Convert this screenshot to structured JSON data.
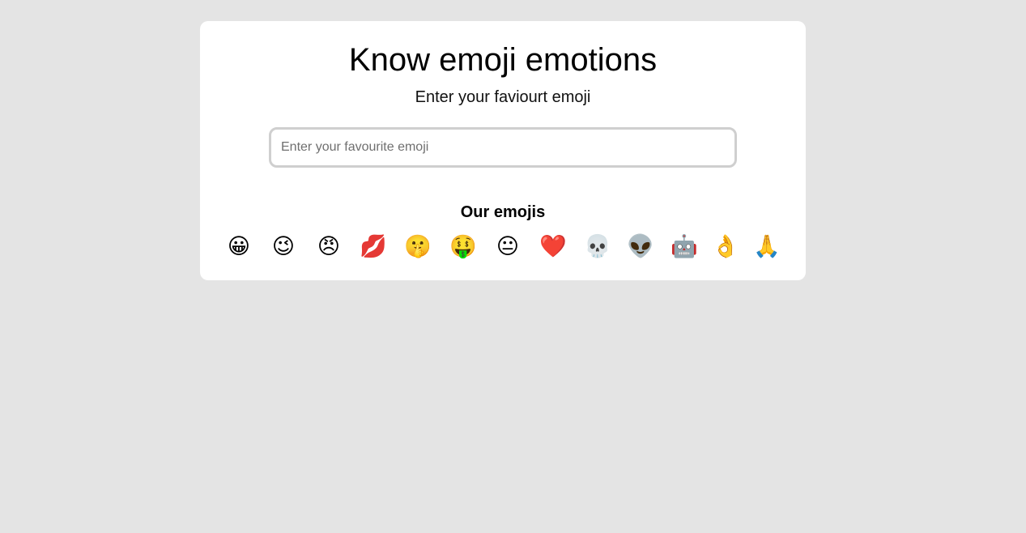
{
  "header": {
    "title": "Know emoji emotions",
    "subtitle": "Enter your faviourt emoji"
  },
  "search": {
    "placeholder": "Enter your favourite emoji",
    "value": ""
  },
  "emojis_section": {
    "heading": "Our emojis",
    "items": [
      {
        "char": "😀",
        "icon": "grinning-face-icon"
      },
      {
        "char": "😉",
        "icon": "winking-face-icon"
      },
      {
        "char": "😠",
        "icon": "angry-face-icon"
      },
      {
        "char": "💋",
        "icon": "kiss-mark-icon"
      },
      {
        "char": "🤫",
        "icon": "shushing-face-icon"
      },
      {
        "char": "🤑",
        "icon": "money-mouth-face-icon"
      },
      {
        "char": "😐",
        "icon": "neutral-face-icon"
      },
      {
        "char": "❤️",
        "icon": "red-heart-icon"
      },
      {
        "char": "💀",
        "icon": "skull-icon"
      },
      {
        "char": "👽",
        "icon": "alien-icon"
      },
      {
        "char": "🤖",
        "icon": "robot-icon"
      },
      {
        "char": "👌",
        "icon": "ok-hand-icon"
      },
      {
        "char": "🙏",
        "icon": "folded-hands-icon"
      }
    ]
  },
  "colors": {
    "page_background": "#e4e4e4",
    "card_background": "#ffffff",
    "input_border": "#cfcfcf"
  }
}
